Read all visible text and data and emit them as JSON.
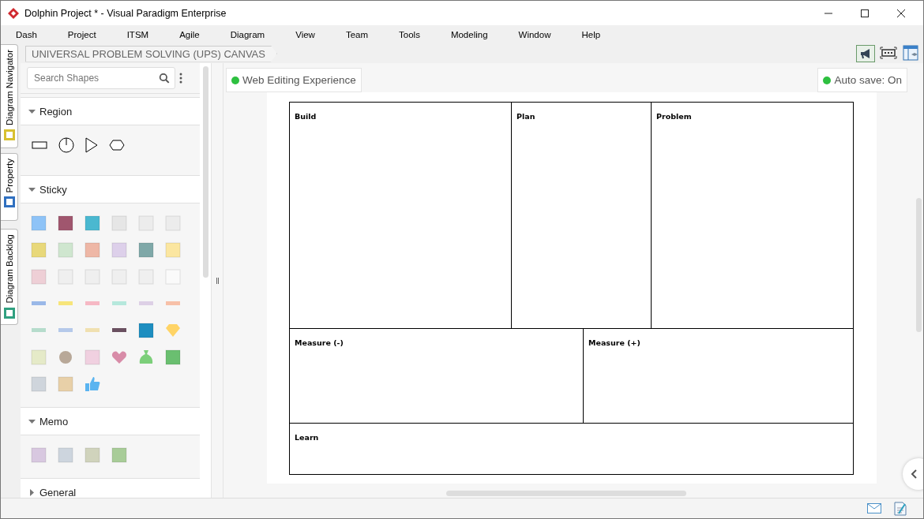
{
  "window": {
    "title": "Dolphin Project * - Visual Paradigm Enterprise"
  },
  "menu": [
    "Dash",
    "Project",
    "ITSM",
    "Agile",
    "Diagram",
    "View",
    "Team",
    "Tools",
    "Modeling",
    "Window",
    "Help"
  ],
  "side_tabs": [
    {
      "label": "Diagram Navigator",
      "kind": "navigator"
    },
    {
      "label": "Property",
      "kind": "property"
    },
    {
      "label": "Diagram Backlog",
      "kind": "backlog"
    }
  ],
  "breadcrumb": "UNIVERSAL PROBLEM SOLVING (UPS) CANVAS",
  "palette": {
    "search": {
      "placeholder": "Search Shapes"
    },
    "sections": [
      {
        "title": "Region",
        "expanded": true,
        "kind": "region"
      },
      {
        "title": "Sticky",
        "expanded": true,
        "kind": "sticky"
      },
      {
        "title": "Memo",
        "expanded": true,
        "kind": "memo"
      },
      {
        "title": "General",
        "expanded": false,
        "kind": "general"
      }
    ]
  },
  "canvas": {
    "web_editing": {
      "label": "Web Editing Experience",
      "on": true
    },
    "autosave": {
      "label": "Auto save: On",
      "on": true
    },
    "canvas_rows": [
      [
        {
          "title": "Build"
        },
        {
          "title": "Plan"
        },
        {
          "title": "Problem"
        }
      ],
      [
        {
          "title": "Measure (-)"
        },
        {
          "title": "Measure (+)"
        }
      ],
      [
        {
          "title": "Learn"
        }
      ]
    ]
  }
}
